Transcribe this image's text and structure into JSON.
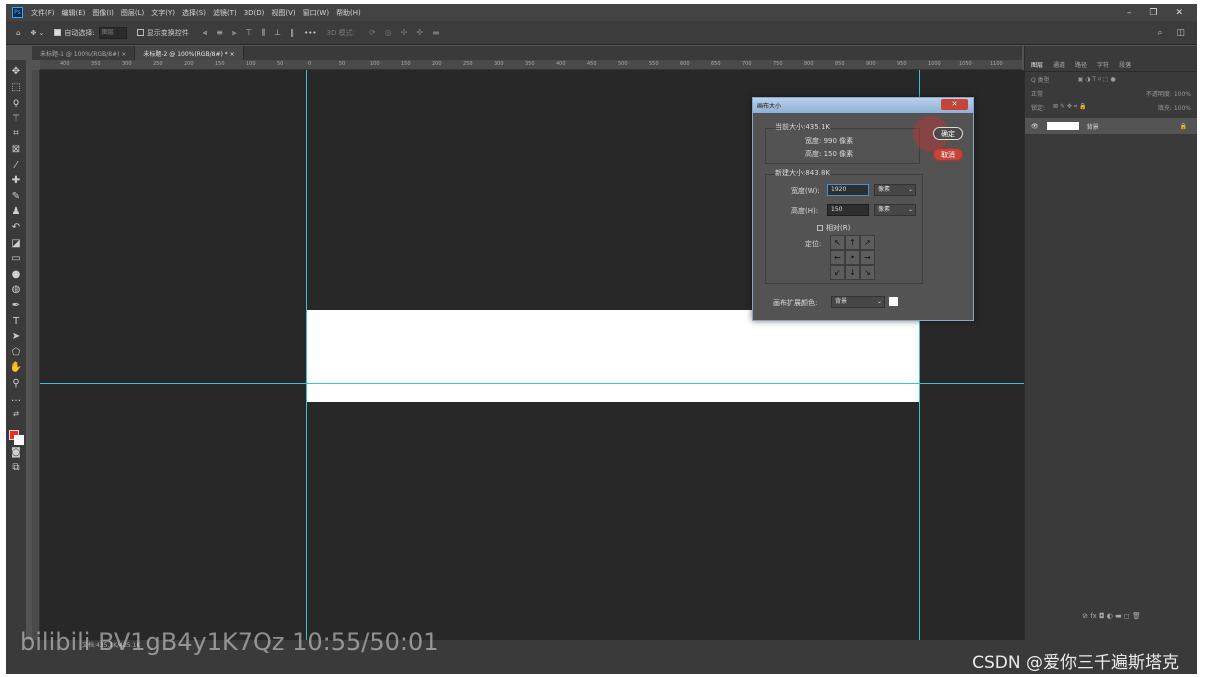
{
  "app": {
    "logo": "Ps"
  },
  "menubar": {
    "items": [
      "文件(F)",
      "编辑(E)",
      "图像(I)",
      "图层(L)",
      "文字(Y)",
      "选择(S)",
      "滤镜(T)",
      "3D(D)",
      "视图(V)",
      "窗口(W)",
      "帮助(H)"
    ]
  },
  "window_controls": {
    "minimize": "–",
    "restore": "❐",
    "close": "✕"
  },
  "options": {
    "auto_select_label": "自动选择:",
    "auto_select_value": "图层",
    "show_transform_label": "显示变换控件",
    "more": "•••",
    "mode_3d": "3D 模式:"
  },
  "tabs": [
    {
      "label": "未标题-1 @ 100%(RGB/8#)",
      "close": "×"
    },
    {
      "label": "未标题-2 @ 100%(RGB/8#) *",
      "close": "×"
    }
  ],
  "ruler_ticks": [
    "400",
    "350",
    "300",
    "250",
    "200",
    "150",
    "100",
    "50",
    "0",
    "50",
    "100",
    "150",
    "200",
    "250",
    "300",
    "350",
    "400",
    "450",
    "500",
    "550",
    "600",
    "650",
    "700",
    "750",
    "800",
    "850",
    "900",
    "950",
    "1000",
    "1050",
    "1100"
  ],
  "panel": {
    "tabs": [
      "图层",
      "通道",
      "路径",
      "字符",
      "段落"
    ],
    "filter": "Q 类型",
    "blend_mode": "正常",
    "opacity": "不透明度: 100%",
    "lock": "锁定:",
    "fill": "填充: 100%",
    "layer_name": "背景",
    "bottom_icons": "⊘ fx ◘ ◐ ▬ ◻ 🗑"
  },
  "dialog": {
    "title": "画布大小",
    "close": "✕",
    "current_size_label": "当前大小:435.1K",
    "current_width": "宽度:  990 像素",
    "current_height": "高度:  150 像素",
    "new_size_label": "新建大小:843.8K",
    "width_label": "宽度(W):",
    "width_value": "1920",
    "width_unit": "像素",
    "height_label": "高度(H):",
    "height_value": "150",
    "height_unit": "像素",
    "relative_label": "相对(R)",
    "anchor_label": "定位:",
    "extension_color_label": "画布扩展颜色:",
    "extension_color_value": "背景",
    "ok": "确定",
    "cancel": "取消",
    "anchor_arrows": [
      "↖",
      "↑",
      "↗",
      "←",
      "•",
      "→",
      "↙",
      "↓",
      "↘"
    ]
  },
  "status": {
    "doc_info": "文档:435.1K/435.1K"
  },
  "watermark": {
    "text": "BV1gB4y1K7Qz 10:55/50:01",
    "credit": "CSDN @爱你三千遍斯塔克"
  },
  "colors": {
    "foreground": "#e8321e",
    "background": "#ffffff",
    "guide": "#3ec0d8",
    "accent": "#c4463a"
  }
}
